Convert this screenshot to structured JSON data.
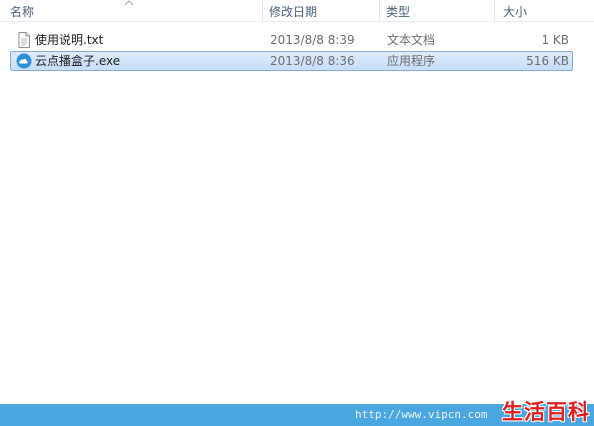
{
  "columns": {
    "name": "名称",
    "modified": "修改日期",
    "type": "类型",
    "size": "大小"
  },
  "files": [
    {
      "name": "使用说明.txt",
      "modified": "2013/8/8 8:39",
      "type": "文本文档",
      "size": "1 KB",
      "icon": "text-file-icon",
      "selected": false
    },
    {
      "name": "云点播盒子.exe",
      "modified": "2013/8/8 8:36",
      "type": "应用程序",
      "size": "516 KB",
      "icon": "cloud-app-icon",
      "selected": true
    }
  ],
  "status": {
    "url": "http://www.vipcn.com"
  },
  "watermark": "生活百科",
  "colors": {
    "selection": "#cde4fb",
    "selection_border": "#84acdd",
    "statusbar": "#4aa6de",
    "watermark": "#e0201f",
    "header_text": "#4c607a"
  }
}
